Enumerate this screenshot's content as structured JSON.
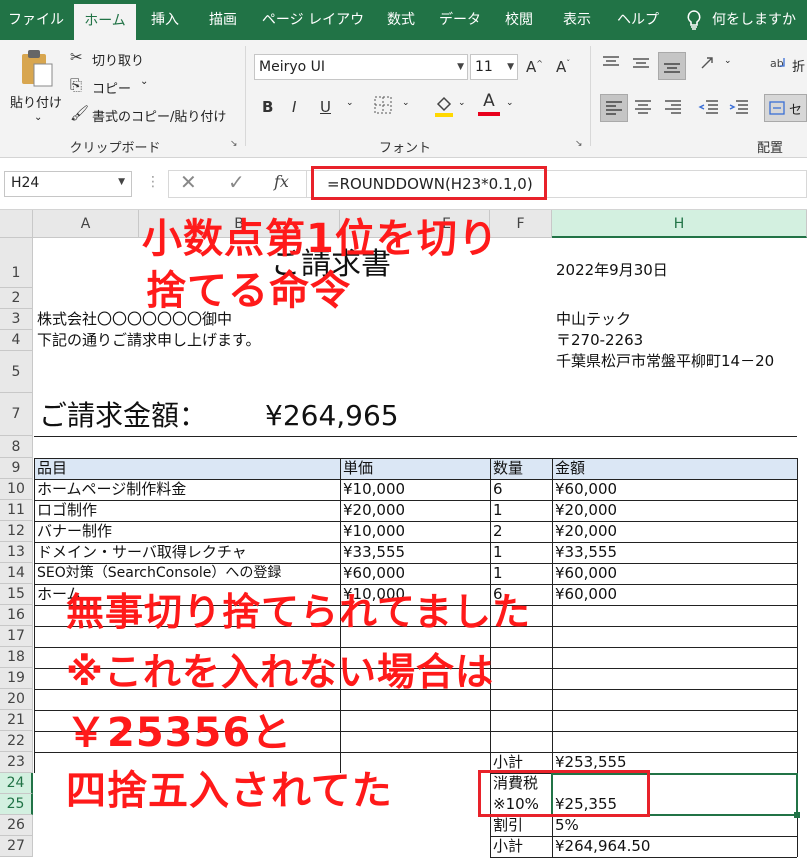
{
  "ribbon": {
    "tabs": [
      "ファイル",
      "ホーム",
      "挿入",
      "描画",
      "ページ レイアウト",
      "数式",
      "データ",
      "校閲",
      "表示",
      "ヘルプ"
    ],
    "tell_me": "何をしますか",
    "clipboard": {
      "paste": "貼り付け",
      "cut": "切り取り",
      "copy": "コピー",
      "format_painter": "書式のコピー/貼り付け",
      "group_label": "クリップボード"
    },
    "font": {
      "name": "Meiryo UI",
      "size": "11",
      "group_label": "フォント"
    },
    "alignment": {
      "group_label": "配置",
      "wrap_label": "折",
      "merge_label": "セ"
    }
  },
  "formula_bar": {
    "name_box": "H24",
    "fx": "fx",
    "formula": "=ROUNDDOWN(H23*0.1,0)"
  },
  "sheet": {
    "columns": [
      "A",
      "B",
      "E",
      "F",
      "H"
    ],
    "rows": [
      "1",
      "2",
      "3",
      "4",
      "5",
      "7",
      "8",
      "9",
      "10",
      "11",
      "12",
      "13",
      "14",
      "15",
      "16",
      "17",
      "18",
      "19",
      "20",
      "21",
      "22",
      "23",
      "24",
      "25",
      "26",
      "27"
    ],
    "title": "ご請求書",
    "date": "2022年9月30日",
    "client": "株式会社〇〇〇〇〇〇〇御中",
    "message": "下記の通りご請求申し上げます。",
    "company": "中山テック",
    "postal": "〒270-2263",
    "address": "千葉県松戸市常盤平柳町14－20",
    "total_label": "ご請求金額：",
    "total_value": "¥264,965",
    "table_headers": [
      "品目",
      "単価",
      "数量",
      "金額"
    ],
    "items": [
      {
        "name": "ホームページ制作料金",
        "price": "¥10,000",
        "qty": "6",
        "amount": "¥60,000"
      },
      {
        "name": "ロゴ制作",
        "price": "¥20,000",
        "qty": "1",
        "amount": "¥20,000"
      },
      {
        "name": "バナー制作",
        "price": "¥10,000",
        "qty": "2",
        "amount": "¥20,000"
      },
      {
        "name": "ドメイン・サーバ取得レクチャ",
        "price": "¥33,555",
        "qty": "1",
        "amount": "¥33,555"
      },
      {
        "name": "SEO対策（SearchConsole）への登録",
        "price": "¥60,000",
        "qty": "1",
        "amount": "¥60,000"
      },
      {
        "name": "ホーム",
        "price": "¥10,000",
        "qty": "6",
        "amount": "¥60,000"
      }
    ],
    "subtotal_label": "小計",
    "subtotal_value": "¥253,555",
    "tax_label": "消費税",
    "tax_rate": "※10%",
    "tax_value": "¥25,355",
    "discount_label": "割引",
    "discount_value": "5%",
    "final_label": "小計",
    "final_value": "¥264,964.50"
  },
  "annotations": {
    "top_line1": "小数点第1位を切り",
    "top_line2": "捨てる命令",
    "mid_line1": "無事切り捨てられてました",
    "mid_line2": "※これを入れない場合は",
    "mid_line3": "￥25356と",
    "mid_line4": "四捨五入されてた"
  },
  "colors": {
    "excel_green": "#217346",
    "annotation_red": "#ff1a1a",
    "header_row_fill": "#dbe7f5"
  }
}
